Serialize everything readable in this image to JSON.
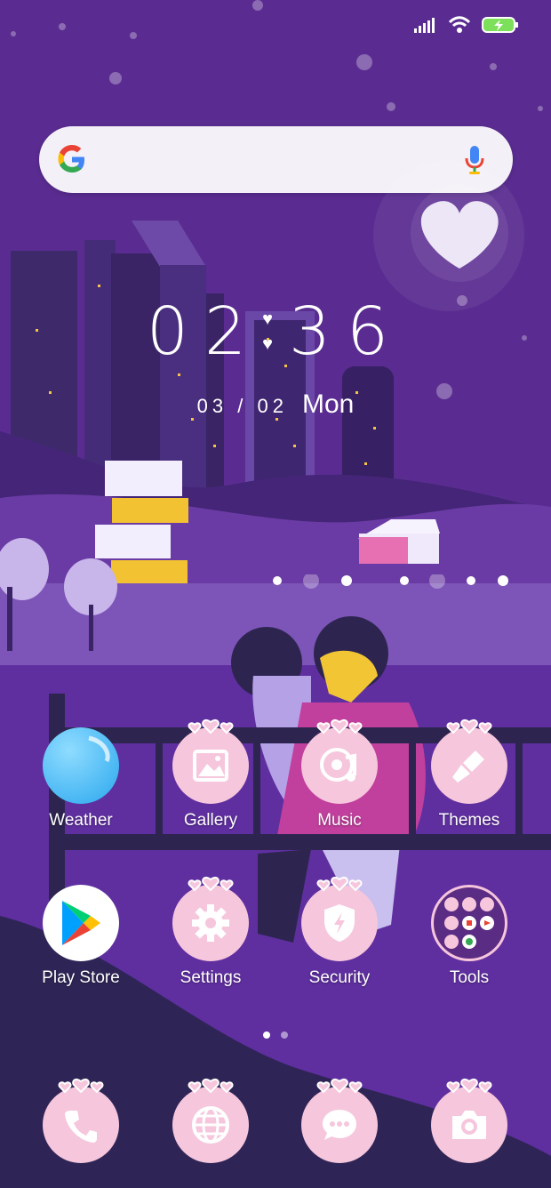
{
  "colors": {
    "background": "#5a2c91",
    "pink_icon": "#f6c6dc",
    "icon_glyph": "#ffffff",
    "accent": "#e83f93"
  },
  "status_bar": {
    "icons": [
      "signal-icon",
      "wifi-icon",
      "battery-charging-icon"
    ]
  },
  "search": {
    "logo": "google-logo",
    "mic": "mic-icon"
  },
  "clock": {
    "hour": "02",
    "minute": "36",
    "separator": "♥",
    "date": "03 / 02",
    "weekday": "Mon"
  },
  "apps_row1": [
    {
      "label": "Weather",
      "icon": "weather-icon"
    },
    {
      "label": "Gallery",
      "icon": "gallery-icon"
    },
    {
      "label": "Music",
      "icon": "music-icon"
    },
    {
      "label": "Themes",
      "icon": "themes-brush-icon"
    }
  ],
  "apps_row2": [
    {
      "label": "Play Store",
      "icon": "play-store-icon"
    },
    {
      "label": "Settings",
      "icon": "gear-icon"
    },
    {
      "label": "Security",
      "icon": "shield-icon"
    },
    {
      "label": "Tools",
      "icon": "folder-icon"
    }
  ],
  "dock": [
    {
      "icon": "phone-icon"
    },
    {
      "icon": "browser-globe-icon"
    },
    {
      "icon": "messages-icon"
    },
    {
      "icon": "camera-icon"
    }
  ],
  "pager": {
    "pages": 2,
    "current": 1
  }
}
